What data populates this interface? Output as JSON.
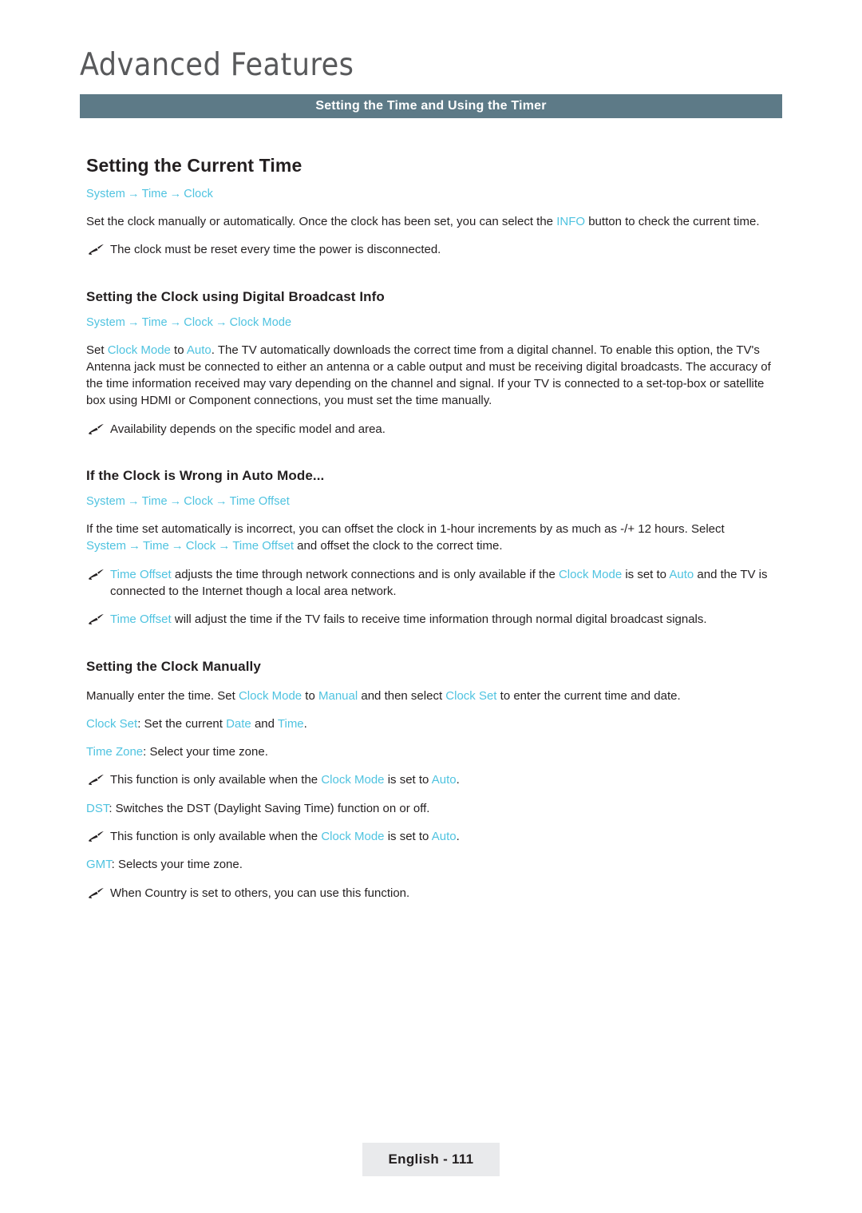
{
  "header": {
    "chapter_title": "Advanced Features",
    "section_bar": "Setting the Time and Using the Timer"
  },
  "main_heading": "Setting the Current Time",
  "paths": {
    "clock": {
      "p1": "System",
      "p2": "Time",
      "p3": "Clock"
    },
    "clock_mode": {
      "p1": "System",
      "p2": "Time",
      "p3": "Clock",
      "p4": "Clock Mode"
    },
    "time_offset": {
      "p1": "System",
      "p2": "Time",
      "p3": "Clock",
      "p4": "Time Offset"
    }
  },
  "arrow": "→",
  "intro": {
    "part1": "Set the clock manually or automatically. Once the clock has been set, you can select the ",
    "info": "INFO",
    "part2": " button to check the current time."
  },
  "note_clock_reset": "The clock must be reset every time the power is disconnected.",
  "digital_broadcast": {
    "heading": "Setting the Clock using Digital Broadcast Info",
    "t1": "Set ",
    "clock_mode": "Clock Mode",
    "t2": " to ",
    "auto": "Auto",
    "t3": ". The TV automatically downloads the correct time from a digital channel. To enable this option, the TV's Antenna jack must be connected to either an antenna or a cable output and must be receiving digital broadcasts. The accuracy of the time information received may vary depending on the channel and signal. If your TV is connected to a set-top-box or satellite box using HDMI or Component connections, you must set the time manually.",
    "note": "Availability depends on the specific model and area."
  },
  "wrong_auto": {
    "heading": "If the Clock is Wrong in Auto Mode...",
    "p1": "If the time set automatically is incorrect, you can offset the clock in 1-hour increments by as much as -/+ 12 hours. Select ",
    "sel_system": "System",
    "sel_time": "Time",
    "sel_clock": "Clock",
    "sel_time_offset": "Time Offset",
    "p2": " and offset the clock to the correct time.",
    "note1_a": "Time Offset",
    "note1_b": " adjusts the time through network connections and is only available if the ",
    "note1_c": "Clock Mode",
    "note1_d": " is set to ",
    "note1_e": "Auto",
    "note1_f": " and the TV is connected to the Internet though a local area network.",
    "note2_a": "Time Offset",
    "note2_b": " will adjust the time if the TV fails to receive time information through normal digital broadcast signals."
  },
  "manual": {
    "heading": "Setting the Clock Manually",
    "p1_a": "Manually enter the time. Set ",
    "p1_clock_mode": "Clock Mode",
    "p1_b": " to ",
    "p1_manual": "Manual",
    "p1_c": " and then select ",
    "p1_clock_set": "Clock Set",
    "p1_d": " to enter the current time and date.",
    "clock_set_label": "Clock Set",
    "clock_set_a": ": Set the current ",
    "clock_set_date": "Date",
    "clock_set_b": " and ",
    "clock_set_time": "Time",
    "clock_set_c": ".",
    "time_zone_label": "Time Zone",
    "time_zone_text": ": Select your time zone.",
    "note_a": "This function is only available when the ",
    "note_clock_mode": "Clock Mode",
    "note_b": " is set to ",
    "note_auto": "Auto",
    "note_c": ".",
    "dst_label": "DST",
    "dst_text": ": Switches the DST (Daylight Saving Time) function on or off.",
    "gmt_label": "GMT",
    "gmt_text": ": Selects your time zone.",
    "note_country": "When Country is set to others, you can use this function."
  },
  "footer": {
    "page_label": "English - 111"
  },
  "colors": {
    "accent": "#4fc3e0",
    "bar": "#5d7a87",
    "title": "#58595b",
    "footer_bg": "#e9eaec"
  }
}
